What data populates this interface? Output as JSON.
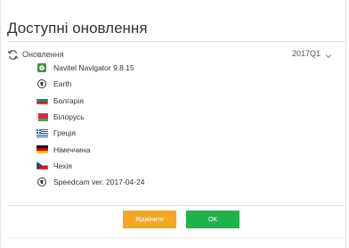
{
  "dialog": {
    "title": "Доступні оновлення"
  },
  "updates": {
    "label": "Оновлення",
    "version": "2017Q1",
    "refresh_icon": "refresh-icon",
    "expand_icon": "chevron-down-icon"
  },
  "items": [
    {
      "label": "Navitel Navigator 9.8.15",
      "icon": "navitel-app-icon"
    },
    {
      "label": "Earth",
      "icon": "globe-icon"
    },
    {
      "label": "Болгарія",
      "icon": "flag-bulgaria-icon"
    },
    {
      "label": "Білорусь",
      "icon": "flag-belarus-icon"
    },
    {
      "label": "Греція",
      "icon": "flag-greece-icon"
    },
    {
      "label": "Німеччина",
      "icon": "flag-germany-icon"
    },
    {
      "label": "Чехія",
      "icon": "flag-czechia-icon"
    },
    {
      "label": "Speedcam ver. 2017-04-24",
      "icon": "speedcam-icon"
    }
  ],
  "buttons": {
    "cancel_label": "Відмінити",
    "ok_label": "OK"
  },
  "colors": {
    "cancel": "#f5a623",
    "ok": "#22b24c"
  }
}
